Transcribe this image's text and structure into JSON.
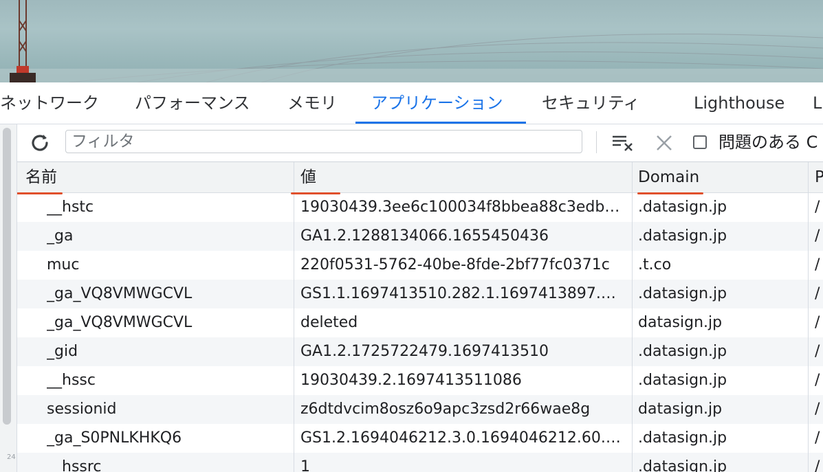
{
  "tabs": [
    {
      "label": "ネットワーク",
      "active": false
    },
    {
      "label": "パフォーマンス",
      "active": false
    },
    {
      "label": "メモリ",
      "active": false
    },
    {
      "label": "アプリケーション",
      "active": true
    },
    {
      "label": "セキュリティ",
      "active": false
    },
    {
      "label": "Lighthouse",
      "active": false
    },
    {
      "label": "L",
      "active": false
    }
  ],
  "toolbar": {
    "filter_placeholder": "フィルタ",
    "filter_value": "",
    "issues_checkbox_label": "問題のある C",
    "issues_checked": false
  },
  "table": {
    "columns": [
      "名前",
      "値",
      "Domain",
      "P"
    ],
    "rows": [
      {
        "name": "__hstc",
        "value": "19030439.3ee6c100034f8bbea88c3edb…",
        "domain": ".datasign.jp",
        "path": "/"
      },
      {
        "name": "_ga",
        "value": "GA1.2.1288134066.1655450436",
        "domain": ".datasign.jp",
        "path": "/"
      },
      {
        "name": "muc",
        "value": "220f0531-5762-40be-8fde-2bf77fc0371c",
        "domain": ".t.co",
        "path": "/"
      },
      {
        "name": "_ga_VQ8VMWGCVL",
        "value": "GS1.1.1697413510.282.1.1697413897.…",
        "domain": ".datasign.jp",
        "path": "/"
      },
      {
        "name": "_ga_VQ8VMWGCVL",
        "value": "deleted",
        "domain": "datasign.jp",
        "path": "/"
      },
      {
        "name": "_gid",
        "value": "GA1.2.1725722479.1697413510",
        "domain": ".datasign.jp",
        "path": "/"
      },
      {
        "name": "__hssc",
        "value": "19030439.2.1697413511086",
        "domain": ".datasign.jp",
        "path": "/"
      },
      {
        "name": "sessionid",
        "value": "z6dtdvcim8osz6o9apc3zsd2r66wae8g",
        "domain": "datasign.jp",
        "path": "/"
      },
      {
        "name": "_ga_S0PNLKHKQ6",
        "value": "GS1.2.1694046212.3.0.1694046212.60.…",
        "domain": ".datasign.jp",
        "path": "/"
      },
      {
        "name": "__hssrc",
        "value": "1",
        "domain": ".datasign.jp",
        "path": "/"
      }
    ]
  },
  "corner_number": "24",
  "annotation_color": "#e0502c",
  "accent_color": "#1a73e8"
}
